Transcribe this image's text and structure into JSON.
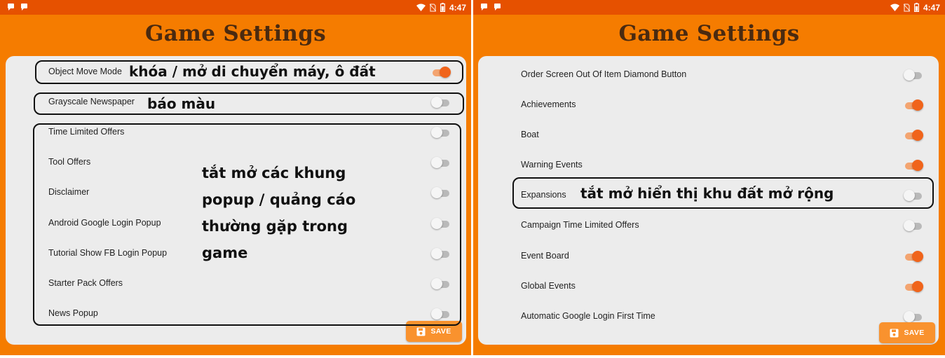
{
  "status_bar": {
    "time": "4:47"
  },
  "save_label": "SAVE",
  "left": {
    "title": "Game Settings",
    "rows": [
      {
        "label": "Object Move Mode",
        "on": true
      },
      {
        "label": "Grayscale Newspaper",
        "on": false
      },
      {
        "label": "Time Limited Offers",
        "on": false
      },
      {
        "label": "Tool Offers",
        "on": false
      },
      {
        "label": "Disclaimer",
        "on": false
      },
      {
        "label": "Android Google Login Popup",
        "on": false
      },
      {
        "label": "Tutorial Show FB Login Popup",
        "on": false
      },
      {
        "label": "Starter Pack Offers",
        "on": false
      },
      {
        "label": "News Popup",
        "on": false
      }
    ],
    "annotations": {
      "move_mode": "khóa / mở di chuyển máy, ô đất",
      "newspaper": "báo màu",
      "popups": [
        "tắt mở các khung",
        "popup / quảng cáo",
        "thường gặp trong",
        "game"
      ]
    }
  },
  "right": {
    "title": "Game Settings",
    "rows": [
      {
        "label": "Order Screen Out Of Item Diamond Button",
        "on": false
      },
      {
        "label": "Achievements",
        "on": true
      },
      {
        "label": "Boat",
        "on": true
      },
      {
        "label": "Warning Events",
        "on": true
      },
      {
        "label": "Expansions",
        "on": false
      },
      {
        "label": "Campaign Time Limited Offers",
        "on": false
      },
      {
        "label": "Event Board",
        "on": true
      },
      {
        "label": "Global Events",
        "on": true
      },
      {
        "label": "Automatic Google Login First Time",
        "on": false
      }
    ],
    "annotations": {
      "expansions": "tắt mở hiển thị khu đất mở rộng"
    }
  },
  "colors": {
    "app_orange": "#f57c00",
    "status_bar": "#e65100",
    "toggle_on": "#f0641b",
    "save_button": "#f9922e",
    "title_brown": "#4a2a10"
  },
  "icons": [
    "notification-icon",
    "wifi-icon",
    "no-sim-icon",
    "battery-icon",
    "save-disk-icon"
  ]
}
